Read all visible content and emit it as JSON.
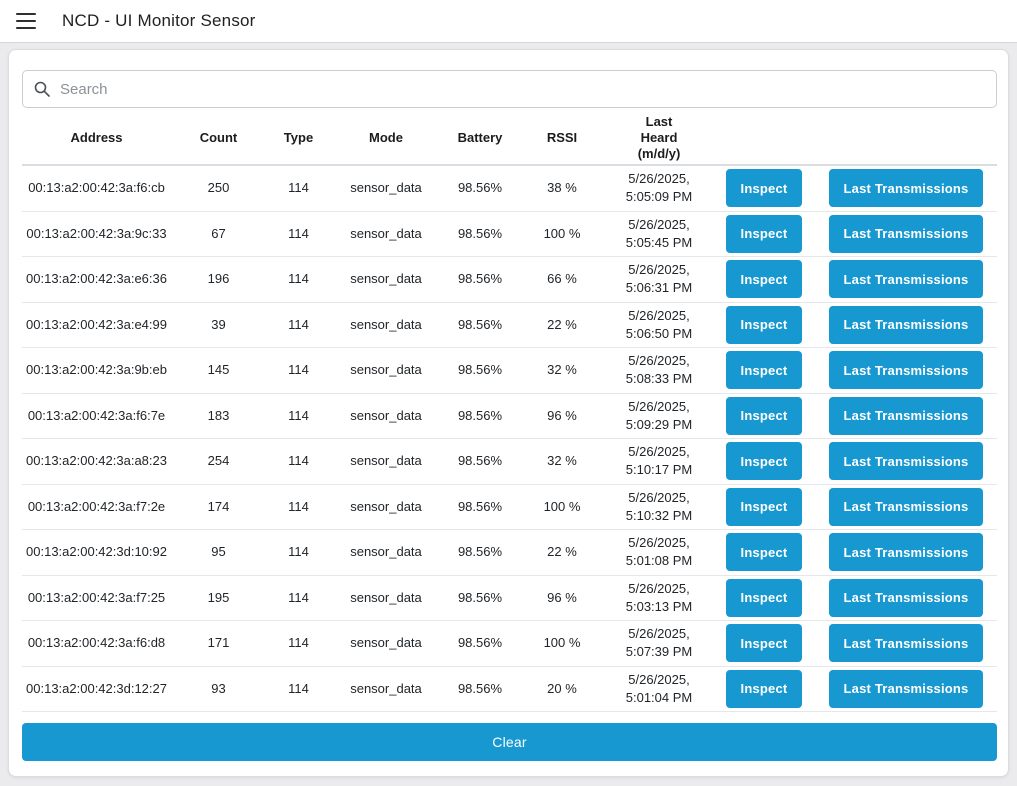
{
  "colors": {
    "accent": "#1898d0",
    "page_bg": "#ebebed"
  },
  "topbar": {
    "title": "NCD - UI Monitor Sensor",
    "menu_icon": "hamburger-icon"
  },
  "search": {
    "placeholder": "Search",
    "value": "",
    "icon": "search-icon"
  },
  "table": {
    "headers": {
      "address": "Address",
      "count": "Count",
      "type": "Type",
      "mode": "Mode",
      "battery": "Battery",
      "rssi": "RSSI",
      "last_heard_lines": [
        "Last",
        "Heard",
        "(m/d/y)"
      ]
    },
    "actions": {
      "inspect_label": "Inspect",
      "last_transmissions_label": "Last Transmissions"
    },
    "rows": [
      {
        "address": "00:13:a2:00:42:3a:f6:cb",
        "count": "250",
        "type": "114",
        "mode": "sensor_data",
        "battery": "98.56%",
        "rssi": "38 %",
        "last_heard_date": "5/26/2025,",
        "last_heard_time": "5:05:09 PM"
      },
      {
        "address": "00:13:a2:00:42:3a:9c:33",
        "count": "67",
        "type": "114",
        "mode": "sensor_data",
        "battery": "98.56%",
        "rssi": "100 %",
        "last_heard_date": "5/26/2025,",
        "last_heard_time": "5:05:45 PM"
      },
      {
        "address": "00:13:a2:00:42:3a:e6:36",
        "count": "196",
        "type": "114",
        "mode": "sensor_data",
        "battery": "98.56%",
        "rssi": "66 %",
        "last_heard_date": "5/26/2025,",
        "last_heard_time": "5:06:31 PM"
      },
      {
        "address": "00:13:a2:00:42:3a:e4:99",
        "count": "39",
        "type": "114",
        "mode": "sensor_data",
        "battery": "98.56%",
        "rssi": "22 %",
        "last_heard_date": "5/26/2025,",
        "last_heard_time": "5:06:50 PM"
      },
      {
        "address": "00:13:a2:00:42:3a:9b:eb",
        "count": "145",
        "type": "114",
        "mode": "sensor_data",
        "battery": "98.56%",
        "rssi": "32 %",
        "last_heard_date": "5/26/2025,",
        "last_heard_time": "5:08:33 PM"
      },
      {
        "address": "00:13:a2:00:42:3a:f6:7e",
        "count": "183",
        "type": "114",
        "mode": "sensor_data",
        "battery": "98.56%",
        "rssi": "96 %",
        "last_heard_date": "5/26/2025,",
        "last_heard_time": "5:09:29 PM"
      },
      {
        "address": "00:13:a2:00:42:3a:a8:23",
        "count": "254",
        "type": "114",
        "mode": "sensor_data",
        "battery": "98.56%",
        "rssi": "32 %",
        "last_heard_date": "5/26/2025,",
        "last_heard_time": "5:10:17 PM"
      },
      {
        "address": "00:13:a2:00:42:3a:f7:2e",
        "count": "174",
        "type": "114",
        "mode": "sensor_data",
        "battery": "98.56%",
        "rssi": "100 %",
        "last_heard_date": "5/26/2025,",
        "last_heard_time": "5:10:32 PM"
      },
      {
        "address": "00:13:a2:00:42:3d:10:92",
        "count": "95",
        "type": "114",
        "mode": "sensor_data",
        "battery": "98.56%",
        "rssi": "22 %",
        "last_heard_date": "5/26/2025,",
        "last_heard_time": "5:01:08 PM"
      },
      {
        "address": "00:13:a2:00:42:3a:f7:25",
        "count": "195",
        "type": "114",
        "mode": "sensor_data",
        "battery": "98.56%",
        "rssi": "96 %",
        "last_heard_date": "5/26/2025,",
        "last_heard_time": "5:03:13 PM"
      },
      {
        "address": "00:13:a2:00:42:3a:f6:d8",
        "count": "171",
        "type": "114",
        "mode": "sensor_data",
        "battery": "98.56%",
        "rssi": "100 %",
        "last_heard_date": "5/26/2025,",
        "last_heard_time": "5:07:39 PM"
      },
      {
        "address": "00:13:a2:00:42:3d:12:27",
        "count": "93",
        "type": "114",
        "mode": "sensor_data",
        "battery": "98.56%",
        "rssi": "20 %",
        "last_heard_date": "5/26/2025,",
        "last_heard_time": "5:01:04 PM"
      }
    ]
  },
  "footer": {
    "clear_label": "Clear"
  }
}
